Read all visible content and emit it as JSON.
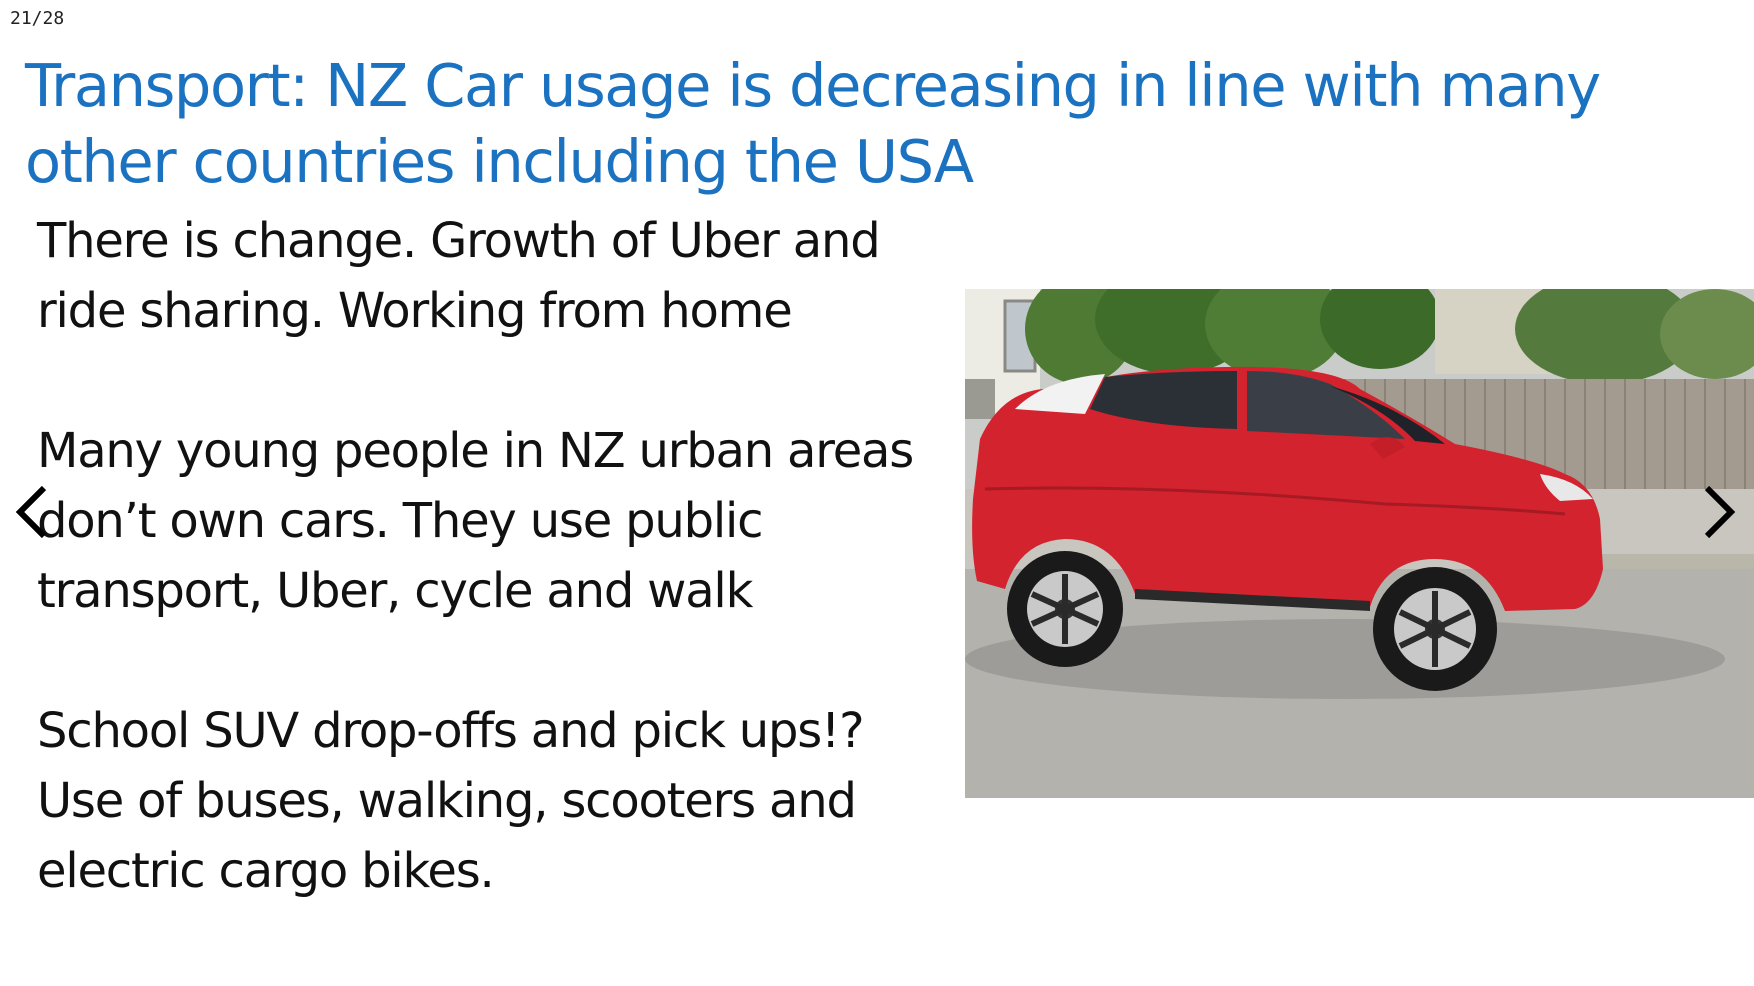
{
  "slide": {
    "counter": "21/28",
    "title": "Transport: NZ Car usage is decreasing in line with many other countries including the USA",
    "paragraphs": [
      {
        "lines": [
          "There is change. Growth of Uber and",
          "ride sharing.  Working from home"
        ]
      },
      {
        "lines": [
          "Many young people in NZ urban areas",
          "don’t own cars. They use public",
          "transport, Uber, cycle and walk"
        ]
      },
      {
        "lines": [
          "School SUV drop-offs and pick ups!?",
          "Use of buses, walking, scooters and",
          "electric cargo bikes."
        ]
      }
    ],
    "image": {
      "subject": "red SUV parked on a street beside a wooden fence"
    }
  },
  "navigation": {
    "prev_icon": "chevron-left-icon",
    "next_icon": "chevron-right-icon"
  },
  "colors": {
    "title": "#1b72c0",
    "body_text": "#111111",
    "car": "#d3232e",
    "background": "#ffffff"
  }
}
